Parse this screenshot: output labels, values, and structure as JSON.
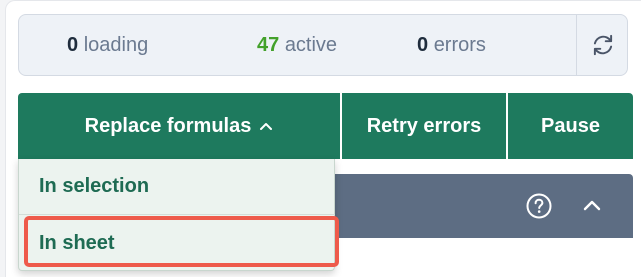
{
  "status": {
    "loading": {
      "count": "0",
      "label": "loading"
    },
    "active": {
      "count": "47",
      "label": "active"
    },
    "errors": {
      "count": "0",
      "label": "errors"
    }
  },
  "toolbar": {
    "replace_label": "Replace formulas",
    "retry_label": "Retry errors",
    "pause_label": "Pause"
  },
  "dropdown": {
    "items": [
      {
        "label": "In selection"
      },
      {
        "label": "In sheet"
      }
    ]
  },
  "icons": {
    "refresh": "refresh-icon",
    "chevron": "chevron-up-icon",
    "help": "help-circle-icon",
    "collapse": "collapse-chevron-icon"
  },
  "colors": {
    "accent": "#1e7a5e",
    "active_count": "#43a12b",
    "highlight": "#ee5a4b",
    "section_header": "#5d6d83"
  }
}
